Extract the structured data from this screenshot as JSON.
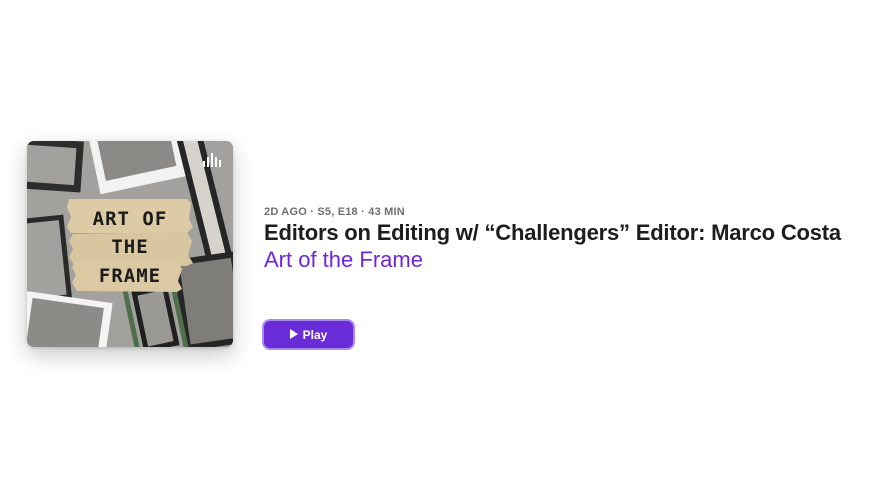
{
  "episode": {
    "meta": "2D AGO · S5, E18 · 43 MIN",
    "title": "Editors on Editing w/ “Challengers” Editor: Marco Costa",
    "show_name": "Art of the Frame"
  },
  "artwork": {
    "lines": [
      "ART OF",
      "THE",
      "FRAME"
    ],
    "icon": "podcast-brand-icon",
    "background_color": "#9e9c99",
    "tape_color": "#d9c9a3"
  },
  "actions": {
    "play_label": "Play",
    "play_icon": "play-icon"
  },
  "colors": {
    "accent": "#6a2bd8",
    "link": "#6e26d9",
    "title": "#1d1d1f",
    "meta": "#6e6e73"
  }
}
